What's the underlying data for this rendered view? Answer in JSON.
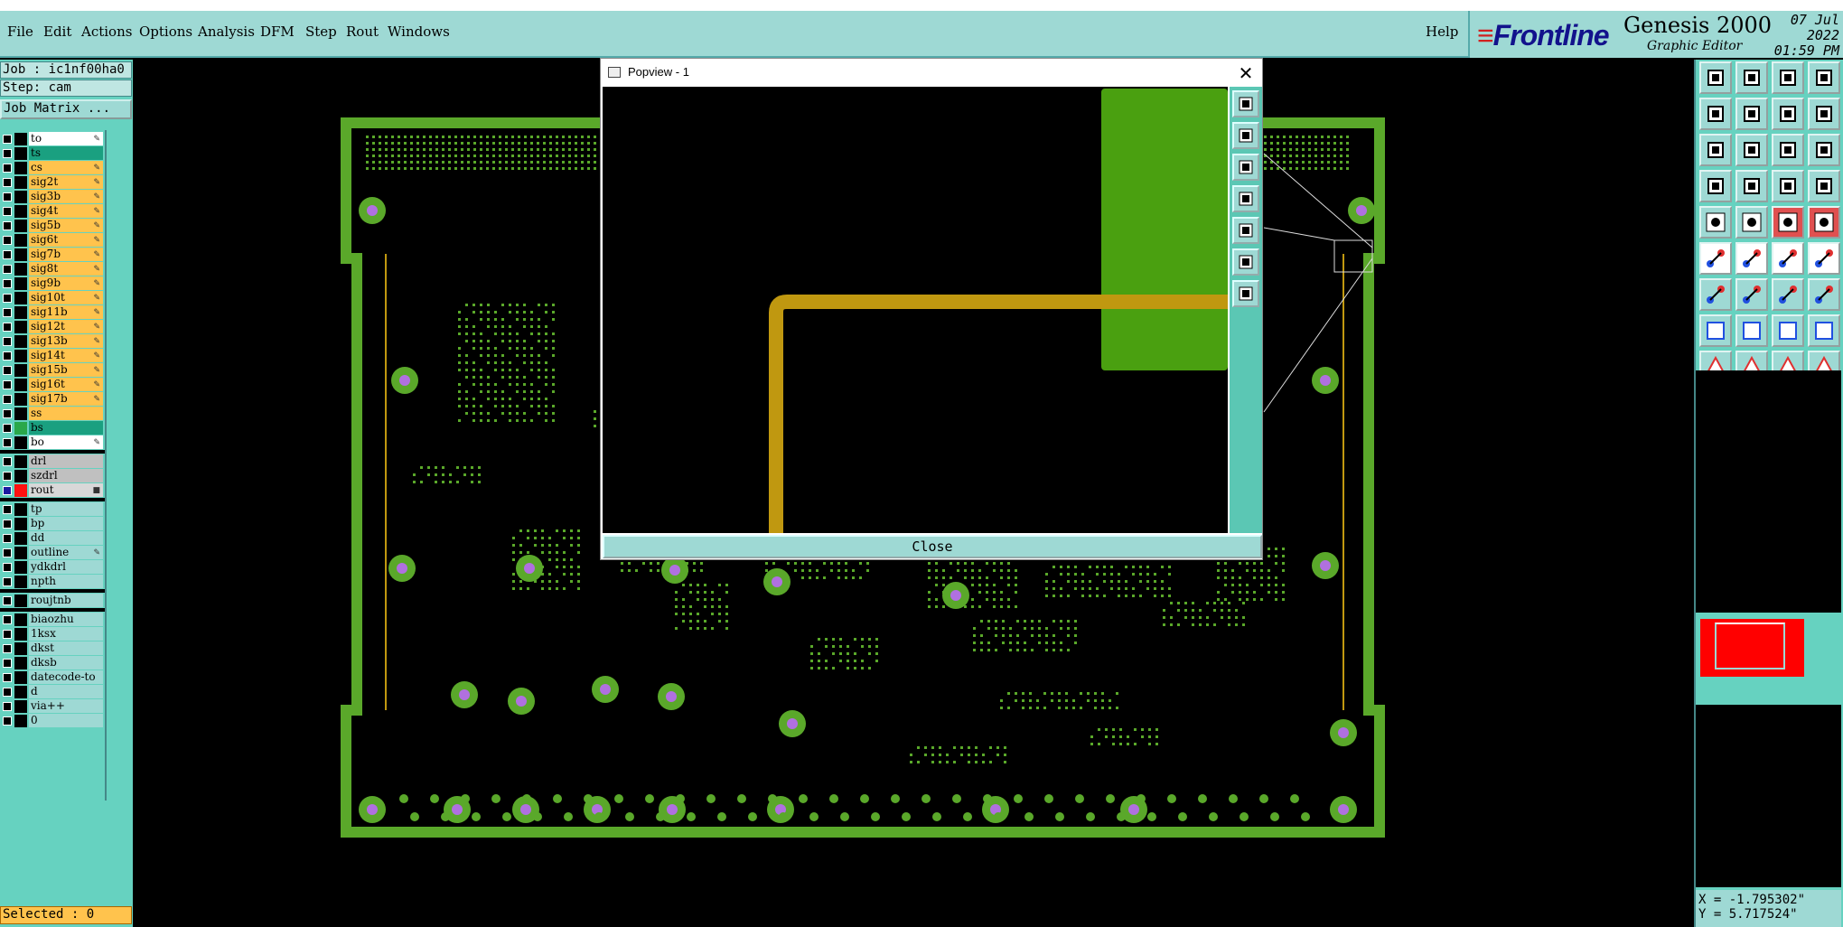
{
  "menu": {
    "file": "File",
    "edit": "Edit",
    "actions": "Actions",
    "options": "Options",
    "analysis": "Analysis",
    "dfm": "DFM",
    "step": "Step",
    "rout": "Rout",
    "windows": "Windows",
    "help": "Help"
  },
  "brand": {
    "logo": "Frontline",
    "product": "Genesis 2000",
    "subtitle": "Graphic Editor",
    "date": "07 Jul 2022",
    "time": "01:59 PM"
  },
  "job": {
    "job_label": "Job : ic1nf00ha0",
    "step_label": "Step: cam",
    "job_matrix": "Job Matrix ..."
  },
  "layers": [
    {
      "name": "to",
      "color": "#ffffff",
      "swatch": "",
      "editable": true
    },
    {
      "name": "ts",
      "color": "#1aa080",
      "swatch": "",
      "editable": false
    },
    {
      "name": "cs",
      "color": "#ffc34d",
      "swatch": "",
      "editable": true
    },
    {
      "name": "sig2t",
      "color": "#ffc34d",
      "swatch": "",
      "editable": true
    },
    {
      "name": "sig3b",
      "color": "#ffc34d",
      "swatch": "",
      "editable": true
    },
    {
      "name": "sig4t",
      "color": "#ffc34d",
      "swatch": "",
      "editable": true
    },
    {
      "name": "sig5b",
      "color": "#ffc34d",
      "swatch": "",
      "editable": true
    },
    {
      "name": "sig6t",
      "color": "#ffc34d",
      "swatch": "",
      "editable": true
    },
    {
      "name": "sig7b",
      "color": "#ffc34d",
      "swatch": "",
      "editable": true
    },
    {
      "name": "sig8t",
      "color": "#ffc34d",
      "swatch": "",
      "editable": true
    },
    {
      "name": "sig9b",
      "color": "#ffc34d",
      "swatch": "",
      "editable": true
    },
    {
      "name": "sig10t",
      "color": "#ffc34d",
      "swatch": "",
      "editable": true
    },
    {
      "name": "sig11b",
      "color": "#ffc34d",
      "swatch": "",
      "editable": true
    },
    {
      "name": "sig12t",
      "color": "#ffc34d",
      "swatch": "",
      "editable": true
    },
    {
      "name": "sig13b",
      "color": "#ffc34d",
      "swatch": "",
      "editable": true
    },
    {
      "name": "sig14t",
      "color": "#ffc34d",
      "swatch": "",
      "editable": true
    },
    {
      "name": "sig15b",
      "color": "#ffc34d",
      "swatch": "",
      "editable": true
    },
    {
      "name": "sig16t",
      "color": "#ffc34d",
      "swatch": "",
      "editable": true
    },
    {
      "name": "sig17b",
      "color": "#ffc34d",
      "swatch": "",
      "editable": true
    },
    {
      "name": "ss",
      "color": "#ffc34d",
      "swatch": "",
      "editable": false
    },
    {
      "name": "bs",
      "color": "#1aa080",
      "swatch": "#2aa84a",
      "editable": false
    },
    {
      "name": "bo",
      "color": "#ffffff",
      "swatch": "",
      "editable": true
    },
    {
      "name": "drl",
      "color": "#c0c0c0",
      "swatch": "",
      "editable": false,
      "gap": true
    },
    {
      "name": "szdrl",
      "color": "#c0c0c0",
      "swatch": "",
      "editable": false
    },
    {
      "name": "rout",
      "color": "#d8d8d8",
      "swatch": "#ff1010",
      "editable": true,
      "active": true
    },
    {
      "name": "tp",
      "color": "#9ed9d4",
      "swatch": "",
      "editable": false,
      "gap": true
    },
    {
      "name": "bp",
      "color": "#9ed9d4",
      "swatch": "",
      "editable": false
    },
    {
      "name": "dd",
      "color": "#9ed9d4",
      "swatch": "",
      "editable": false
    },
    {
      "name": "outline",
      "color": "#9ed9d4",
      "swatch": "",
      "editable": true
    },
    {
      "name": "ydkdrl",
      "color": "#9ed9d4",
      "swatch": "",
      "editable": false
    },
    {
      "name": "npth",
      "color": "#9ed9d4",
      "swatch": "",
      "editable": false
    },
    {
      "name": "roujtnb",
      "color": "#9ed9d4",
      "swatch": "",
      "editable": false,
      "gap": true
    },
    {
      "name": "biaozhu",
      "color": "#9ed9d4",
      "swatch": "",
      "editable": false,
      "gap": true
    },
    {
      "name": "1ksx",
      "color": "#9ed9d4",
      "swatch": "",
      "editable": false
    },
    {
      "name": "dkst",
      "color": "#9ed9d4",
      "swatch": "",
      "editable": false
    },
    {
      "name": "dksb",
      "color": "#9ed9d4",
      "swatch": "",
      "editable": false
    },
    {
      "name": "datecode-to",
      "color": "#9ed9d4",
      "swatch": "",
      "editable": false
    },
    {
      "name": "d",
      "color": "#9ed9d4",
      "swatch": "",
      "editable": false
    },
    {
      "name": "via++",
      "color": "#9ed9d4",
      "swatch": "",
      "editable": false
    },
    {
      "name": "0",
      "color": "#9ed9d4",
      "swatch": "",
      "editable": false
    }
  ],
  "status": {
    "selected": "Selected : 0",
    "x": "X = -1.795302\"",
    "y": "Y = 5.717524\""
  },
  "popup": {
    "title": "Popview - 1",
    "close_label": "Close"
  },
  "toolbar_icons": [
    "home-icon",
    "save-icon",
    "house-icon",
    "layout-icon",
    "open-left-icon",
    "open-right-icon",
    "undo-icon",
    "redo-icon",
    "zoom-fit-icon",
    "zoom-pan-icon",
    "scale-icon",
    "help-icon",
    "settings-icon",
    "key-icon",
    "route-icon",
    "route2-icon",
    "add-pad-icon",
    "add-line-icon",
    "add-bar-icon",
    "add-circle-icon",
    "move-icon",
    "cross-icon",
    "connect-icon",
    "connect2-icon",
    "angle-icon",
    "line-icon",
    "arc-icon",
    "split-icon",
    "measure-icon",
    "minus-icon",
    "resize-icon",
    "group-icon",
    "select-tri-icon",
    "select-tri2-icon",
    "select-tri3-icon",
    "select-tri4-icon",
    "pointer-icon",
    "pointer2-icon",
    "pointer3-icon",
    "pointer4-icon"
  ],
  "colors": {
    "board": "#5aa82a",
    "pad": "#b070e0",
    "trace": "#c09810",
    "panel": "#66d2c0",
    "menu": "#9ed9d4"
  }
}
